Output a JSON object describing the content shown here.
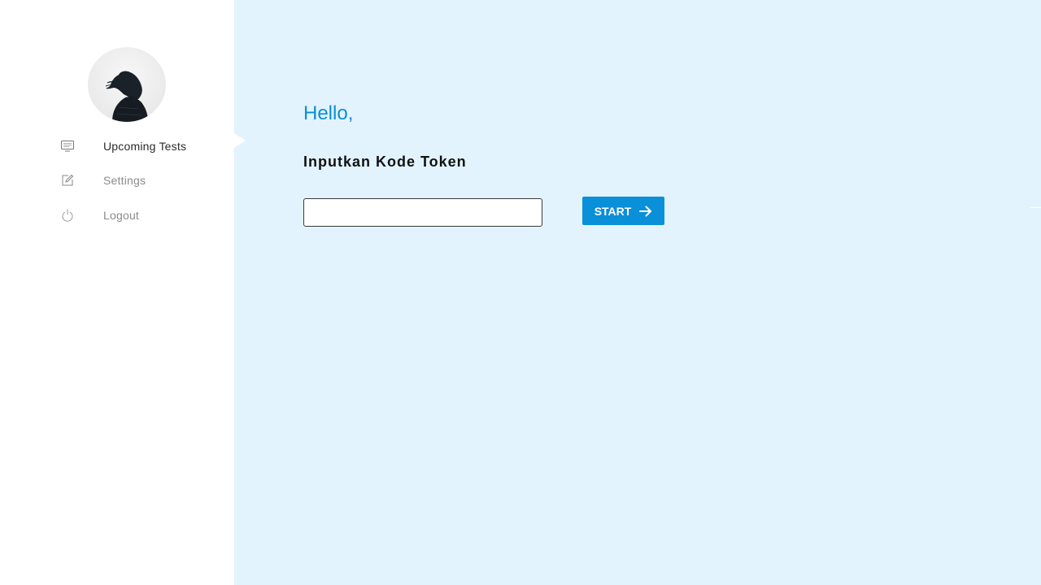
{
  "sidebar": {
    "avatar_alt": "",
    "items": [
      {
        "label": "Upcoming Tests",
        "icon": "monitor-icon",
        "active": true
      },
      {
        "label": "Settings",
        "icon": "edit-icon",
        "active": false
      },
      {
        "label": "Logout",
        "icon": "power-icon",
        "active": false
      }
    ]
  },
  "main": {
    "greeting": "Hello,",
    "prompt": "Inputkan Kode Token",
    "token_input": {
      "value": "",
      "placeholder": ""
    },
    "start_label": "START"
  },
  "colors": {
    "accent": "#0a8fd9",
    "background": "#e2f3fd",
    "sidebar": "#ffffff"
  }
}
